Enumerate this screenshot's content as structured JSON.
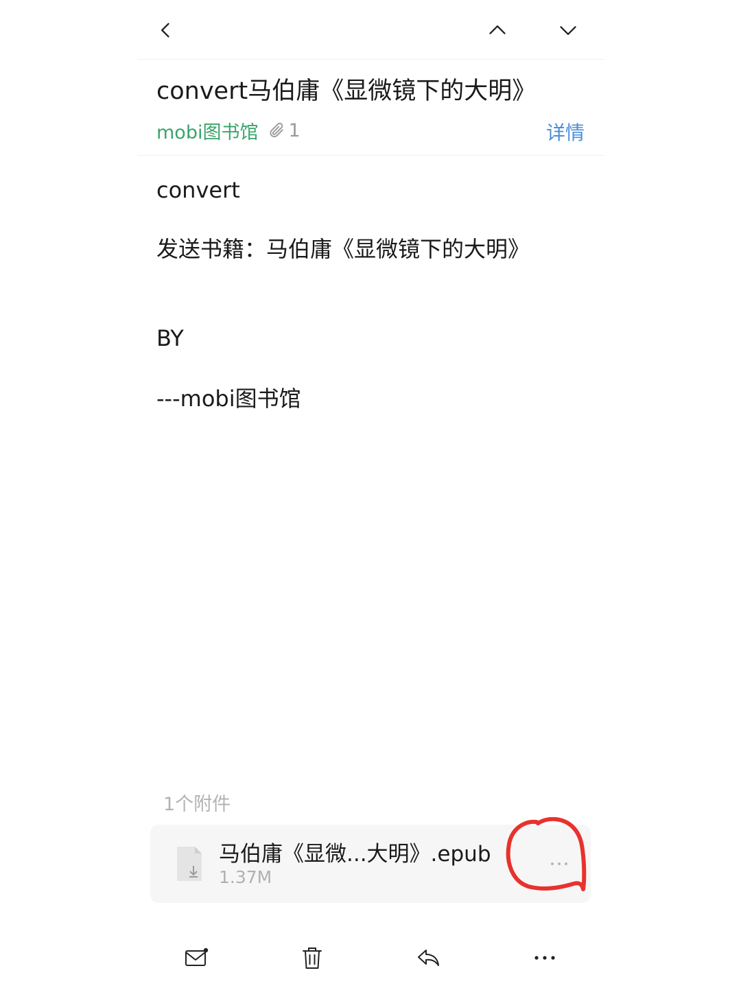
{
  "header": {
    "back_icon": "chevron-left-icon",
    "prev_icon": "chevron-up-icon",
    "next_icon": "chevron-down-icon"
  },
  "email": {
    "subject": "convert马伯庸《显微镜下的大明》",
    "sender": "mobi图书馆",
    "attachment_count_badge": "1",
    "details_link": "详情",
    "sender_color": "#3aa56b",
    "link_color": "#4a8fd8"
  },
  "body": {
    "lines": [
      "convert",
      "发送书籍：马伯庸《显微镜下的大明》",
      "BY",
      "---mobi图书馆"
    ]
  },
  "attachments": {
    "heading": "1个附件",
    "items": [
      {
        "name": "马伯庸《显微...大明》.epub",
        "size": "1.37M",
        "icon": "file-download-icon",
        "more_icon": "more-horizontal-icon"
      }
    ],
    "annotation_color": "#e8322d"
  },
  "toolbar": {
    "items": [
      {
        "icon": "mail-unread-icon"
      },
      {
        "icon": "trash-icon"
      },
      {
        "icon": "reply-icon"
      },
      {
        "icon": "more-horizontal-icon"
      }
    ]
  }
}
